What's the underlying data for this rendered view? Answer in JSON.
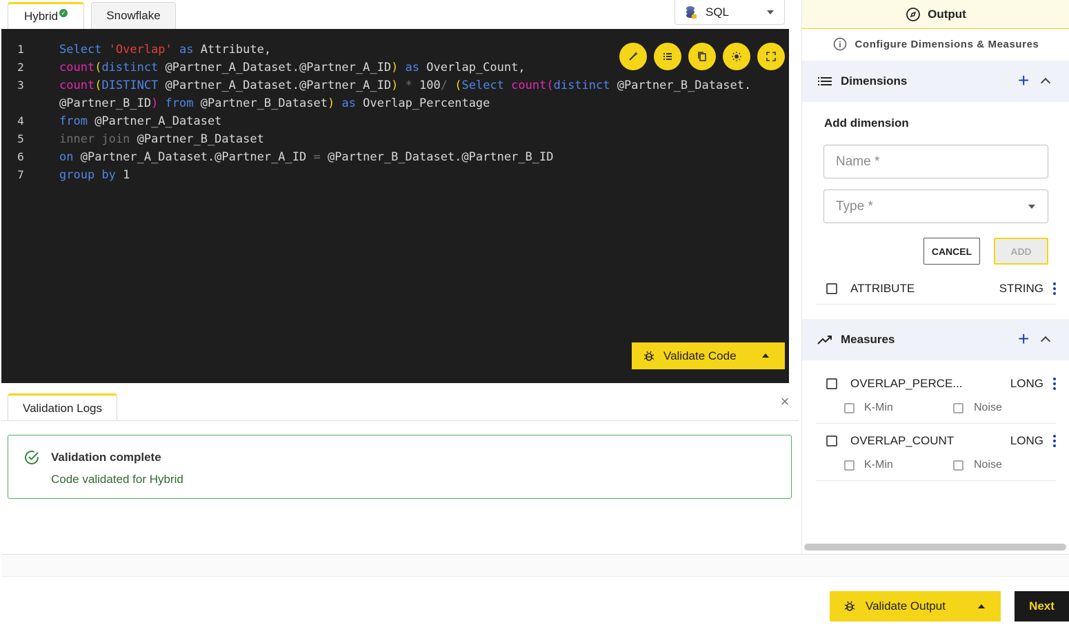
{
  "editor_tabs": [
    {
      "label": "Hybrid",
      "active": true,
      "status": "validated"
    },
    {
      "label": "Snowflake",
      "active": false
    }
  ],
  "language_select": {
    "value": "SQL",
    "icon": "database-icon"
  },
  "toolbar_icons": [
    "magic-wand-icon",
    "list-format-icon",
    "copy-icon",
    "theme-icon",
    "expand-icon"
  ],
  "code": {
    "line_numbers": [
      "1",
      "2",
      "3",
      "",
      "4",
      "5",
      "6",
      "7"
    ],
    "lines": [
      [
        {
          "t": "Select ",
          "c": "kw"
        },
        {
          "t": "'Overlap'",
          "c": "str"
        },
        {
          "t": " as ",
          "c": "kw"
        },
        {
          "t": "Attribute,",
          "c": "id"
        }
      ],
      [
        {
          "t": "count",
          "c": "fn"
        },
        {
          "t": "(",
          "c": "par"
        },
        {
          "t": "distinct ",
          "c": "kw"
        },
        {
          "t": "@Partner_A_Dataset.@Partner_A_ID",
          "c": "id"
        },
        {
          "t": ")",
          "c": "par"
        },
        {
          "t": " as ",
          "c": "kw"
        },
        {
          "t": "Overlap_Count,",
          "c": "id"
        }
      ],
      [
        {
          "t": "count",
          "c": "fn"
        },
        {
          "t": "(",
          "c": "par"
        },
        {
          "t": "DISTINCT ",
          "c": "kw"
        },
        {
          "t": "@Partner_A_Dataset.@Partner_A_ID",
          "c": "id"
        },
        {
          "t": ")",
          "c": "par"
        },
        {
          "t": " * ",
          "c": "dim"
        },
        {
          "t": "100",
          "c": "num"
        },
        {
          "t": "/ ",
          "c": "dim"
        },
        {
          "t": "(",
          "c": "par"
        },
        {
          "t": "Select ",
          "c": "kw"
        },
        {
          "t": "count",
          "c": "fn"
        },
        {
          "t": "(",
          "c": "fn"
        },
        {
          "t": "distinct ",
          "c": "kw"
        },
        {
          "t": "@Partner_B_Dataset.",
          "c": "id"
        }
      ],
      [
        {
          "t": "@Partner_B_ID",
          "c": "id"
        },
        {
          "t": ")",
          "c": "fn"
        },
        {
          "t": " from ",
          "c": "kw"
        },
        {
          "t": "@Partner_B_Dataset",
          "c": "id"
        },
        {
          "t": ")",
          "c": "par"
        },
        {
          "t": " as ",
          "c": "kw"
        },
        {
          "t": "Overlap_Percentage",
          "c": "id"
        }
      ],
      [
        {
          "t": "from ",
          "c": "kw"
        },
        {
          "t": "@Partner_A_Dataset",
          "c": "id"
        }
      ],
      [
        {
          "t": "inner join ",
          "c": "dim"
        },
        {
          "t": "@Partner_B_Dataset",
          "c": "id"
        }
      ],
      [
        {
          "t": "on ",
          "c": "kw"
        },
        {
          "t": "@Partner_A_Dataset.@Partner_A_ID",
          "c": "id"
        },
        {
          "t": " = ",
          "c": "dim"
        },
        {
          "t": "@Partner_B_Dataset.@Partner_B_ID",
          "c": "id"
        }
      ],
      [
        {
          "t": "group by ",
          "c": "kw"
        },
        {
          "t": "1",
          "c": "num"
        }
      ]
    ]
  },
  "validate_code": {
    "label": "Validate Code",
    "icon": "bug-icon"
  },
  "logs": {
    "tab_label": "Validation Logs",
    "title": "Validation complete",
    "message": "Code validated for Hybrid",
    "icon": "check-circle-icon"
  },
  "right_panel": {
    "title": "Output",
    "subtitle": "Configure Dimensions & Measures",
    "dimensions": {
      "title": "Dimensions",
      "add_title": "Add dimension",
      "name_placeholder": "Name *",
      "type_placeholder": "Type *",
      "cancel_label": "CANCEL",
      "add_label": "ADD",
      "items": [
        {
          "name": "ATTRIBUTE",
          "type": "STRING"
        }
      ]
    },
    "measures": {
      "title": "Measures",
      "items": [
        {
          "name": "OVERLAP_PERCE...",
          "type": "LONG",
          "opt1": "K-Min",
          "opt2": "Noise"
        },
        {
          "name": "OVERLAP_COUNT",
          "type": "LONG",
          "opt1": "K-Min",
          "opt2": "Noise"
        }
      ]
    }
  },
  "bottom": {
    "validate_output_label": "Validate Output",
    "next_label": "Next"
  },
  "colors": {
    "accent": "#f5d517",
    "editor_bg": "#1e1e1e",
    "success": "#4bb25a",
    "link_blue": "#1a3fb8"
  }
}
